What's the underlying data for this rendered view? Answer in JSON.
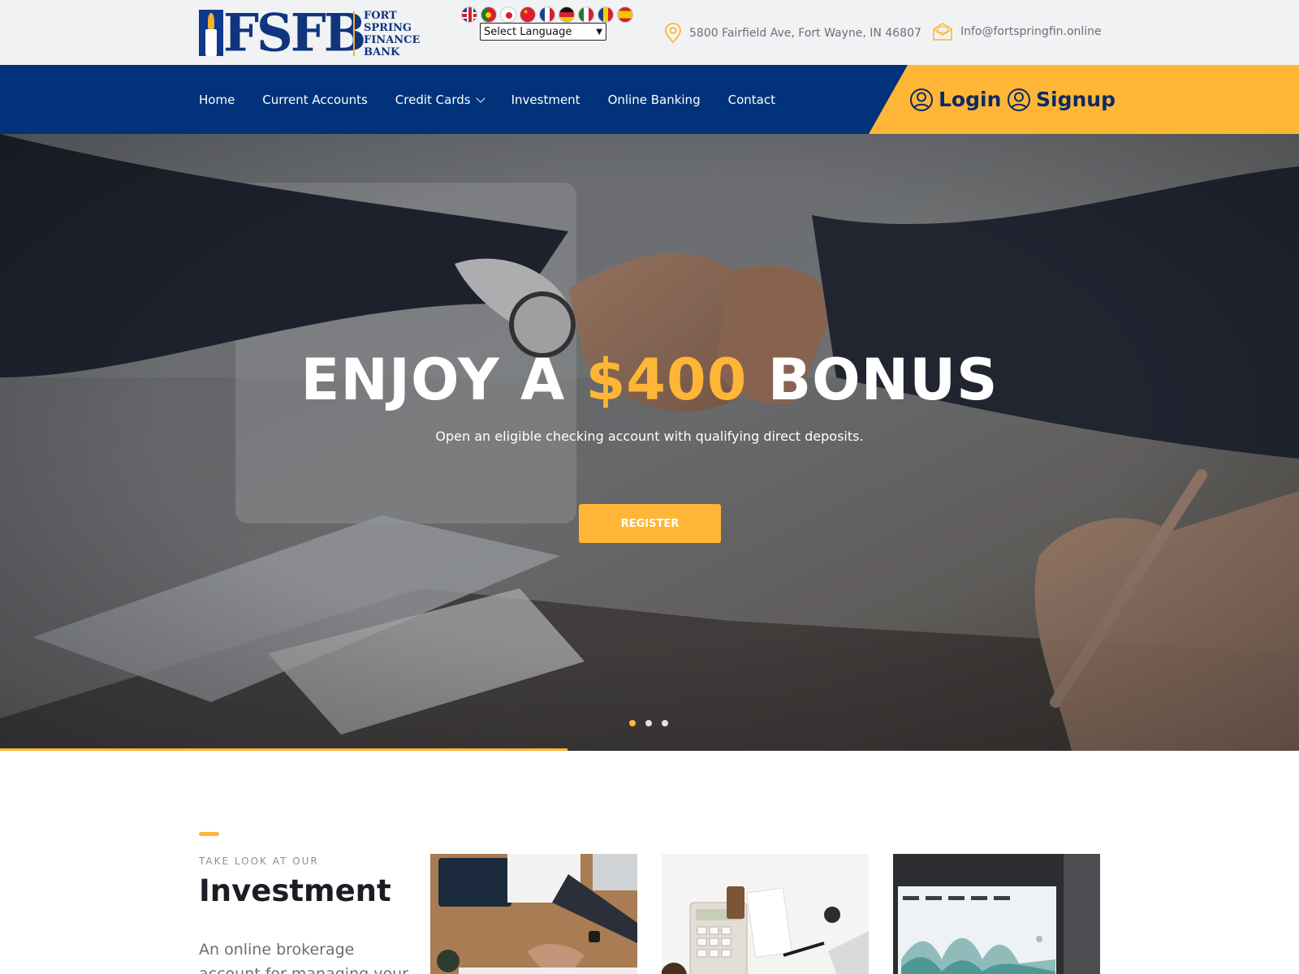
{
  "brand": {
    "logo_letters": "FSFB",
    "logo_lines": [
      "FORT",
      "SPRING",
      "FINANCE",
      "BANK"
    ]
  },
  "language": {
    "flags": [
      "english-flag-icon",
      "portuguese-flag-icon",
      "japanese-flag-icon",
      "chinese-flag-icon",
      "french-flag-icon",
      "german-flag-icon",
      "italian-flag-icon",
      "romanian-flag-icon",
      "spanish-flag-icon"
    ],
    "select_value": "Select Language"
  },
  "contact": {
    "address": "5800 Fairfield Ave, Fort Wayne, IN 46807",
    "email": "Info@fortspringfin.online"
  },
  "nav": {
    "items": [
      {
        "label": "Home"
      },
      {
        "label": "Current Accounts"
      },
      {
        "label": "Credit Cards"
      },
      {
        "label": "Investment"
      },
      {
        "label": "Online Banking"
      },
      {
        "label": "Contact"
      }
    ],
    "login": "Login",
    "signup": "Signup"
  },
  "hero": {
    "title_prefix": "ENJOY A",
    "title_accent": "$400",
    "title_suffix": "BONUS",
    "subtitle": "Open an eligible checking account with qualifying direct deposits.",
    "cta": "REGISTER",
    "slide_count": 3,
    "active_slide": 1
  },
  "investment": {
    "kicker": "TAKE LOOK AT OUR",
    "title": "Investment",
    "body": "An online brokerage account for managing your own"
  },
  "colors": {
    "navy": "#01327a",
    "accent": "#ffb637",
    "topbar": "#f1f2f4"
  }
}
